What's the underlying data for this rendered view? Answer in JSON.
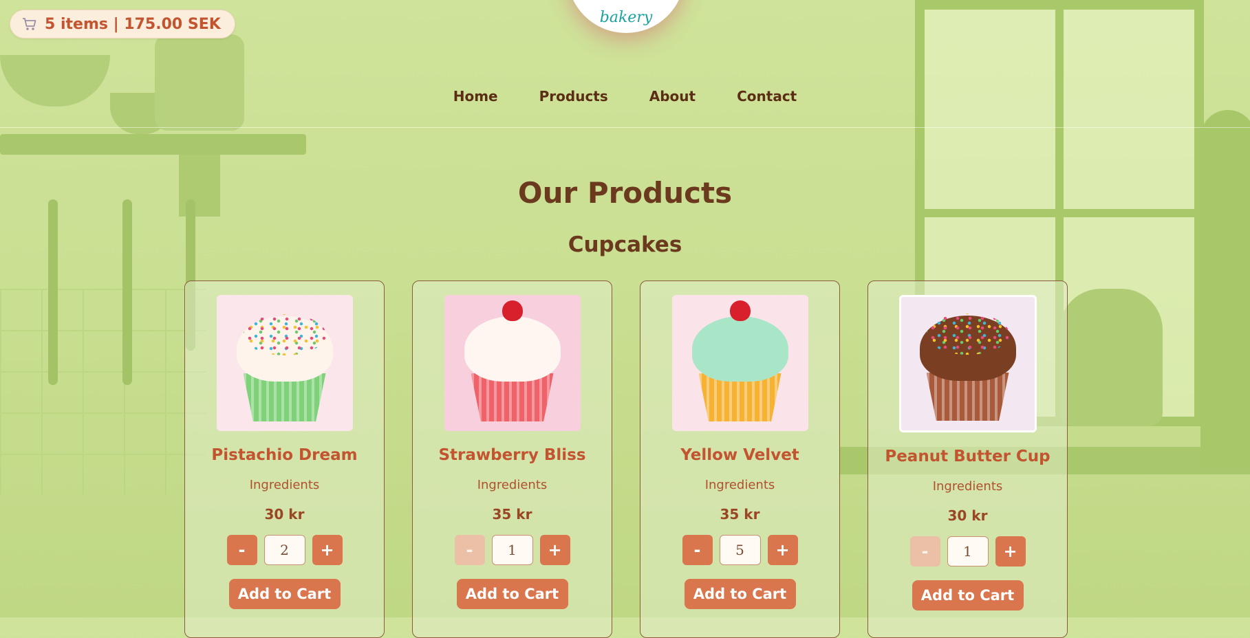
{
  "cart": {
    "summary": "5 items | 175.00 SEK",
    "icon": "cart-icon"
  },
  "logo": {
    "text": "bakery"
  },
  "nav": {
    "items": [
      {
        "label": "Home"
      },
      {
        "label": "Products"
      },
      {
        "label": "About"
      },
      {
        "label": "Contact"
      }
    ]
  },
  "page": {
    "title": "Our Products",
    "section": "Cupcakes"
  },
  "products": [
    {
      "name": "Pistachio Dream",
      "ingredients_label": "Ingredients",
      "price": "30 kr",
      "quantity": "2",
      "minus_label": "-",
      "plus_label": "+",
      "add_label": "Add to Cart",
      "minus_enabled": true,
      "liner_color": "#7fd27a",
      "frosting_color": "#fff4ec",
      "topping": "sprinkles",
      "bg_color": "#fbe6ec"
    },
    {
      "name": "Strawberry Bliss",
      "ingredients_label": "Ingredients",
      "price": "35 kr",
      "quantity": "1",
      "minus_label": "-",
      "plus_label": "+",
      "add_label": "Add to Cart",
      "minus_enabled": false,
      "liner_color": "#f0626a",
      "frosting_color": "#fff6f2",
      "topping": "strawberry",
      "bg_color": "#f8cfdc"
    },
    {
      "name": "Yellow Velvet",
      "ingredients_label": "Ingredients",
      "price": "35 kr",
      "quantity": "5",
      "minus_label": "-",
      "plus_label": "+",
      "add_label": "Add to Cart",
      "minus_enabled": true,
      "liner_color": "#f7b233",
      "frosting_color": "#a9e6c8",
      "topping": "strawberry",
      "bg_color": "#fbe3ea"
    },
    {
      "name": "Peanut Butter Cup",
      "ingredients_label": "Ingredients",
      "price": "30 kr",
      "quantity": "1",
      "minus_label": "-",
      "plus_label": "+",
      "add_label": "Add to Cart",
      "minus_enabled": false,
      "liner_color": "#a85a3a",
      "frosting_color": "#7a3e22",
      "topping": "sprinkles",
      "bg_color": "#f3e8f2"
    }
  ]
}
